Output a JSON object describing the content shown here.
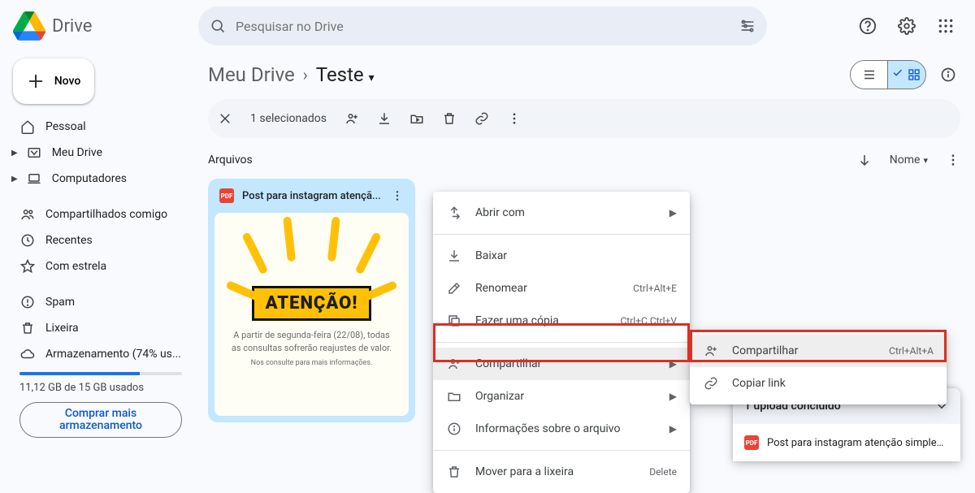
{
  "app": {
    "title": "Drive"
  },
  "search": {
    "placeholder": "Pesquisar no Drive"
  },
  "sidebar": {
    "new_label": "Novo",
    "items": [
      {
        "label": "Pessoal"
      },
      {
        "label": "Meu Drive"
      },
      {
        "label": "Computadores"
      },
      {
        "label": "Compartilhados comigo"
      },
      {
        "label": "Recentes"
      },
      {
        "label": "Com estrela"
      },
      {
        "label": "Spam"
      },
      {
        "label": "Lixeira"
      },
      {
        "label": "Armazenamento (74% us..."
      }
    ],
    "storage_percent": 74,
    "storage_text": "11,12 GB de 15 GB usados",
    "buy_label": "Comprar mais armazenamento"
  },
  "breadcrumb": {
    "root": "Meu Drive",
    "current": "Teste"
  },
  "action_bar": {
    "selected_label": "1 selecionados"
  },
  "section": {
    "title": "Arquivos",
    "sort": "Nome"
  },
  "file": {
    "name": "Post para instagram atençã...",
    "banner": "ATENÇÃO!",
    "body": "A partir de segunda-feira (22/08), todas as consultas sofrerão reajustes de valor.",
    "body2": "Nos consulte para mais informações."
  },
  "menu1": [
    {
      "icon": "open",
      "label": "Abrir com",
      "sub": "",
      "arrow": true
    },
    null,
    {
      "icon": "download",
      "label": "Baixar",
      "sub": ""
    },
    {
      "icon": "rename",
      "label": "Renomear",
      "sub": "Ctrl+Alt+E"
    },
    {
      "icon": "copy",
      "label": "Fazer uma cópia",
      "sub": "Ctrl+C Ctrl+V"
    },
    null,
    {
      "icon": "share",
      "label": "Compartilhar",
      "sub": "",
      "arrow": true,
      "hov": true
    },
    {
      "icon": "folder",
      "label": "Organizar",
      "sub": "",
      "arrow": true
    },
    {
      "icon": "info",
      "label": "Informações sobre o arquivo",
      "sub": "",
      "arrow": true
    },
    null,
    {
      "icon": "trash",
      "label": "Mover para a lixeira",
      "sub": "Delete"
    }
  ],
  "menu2": [
    {
      "icon": "share",
      "label": "Compartilhar",
      "sub": "Ctrl+Alt+A",
      "hov": true
    },
    {
      "icon": "link",
      "label": "Copiar link",
      "sub": ""
    }
  ],
  "toast": {
    "title": "1 upload concluído",
    "file": "Post para instagram atenção simples ..."
  }
}
